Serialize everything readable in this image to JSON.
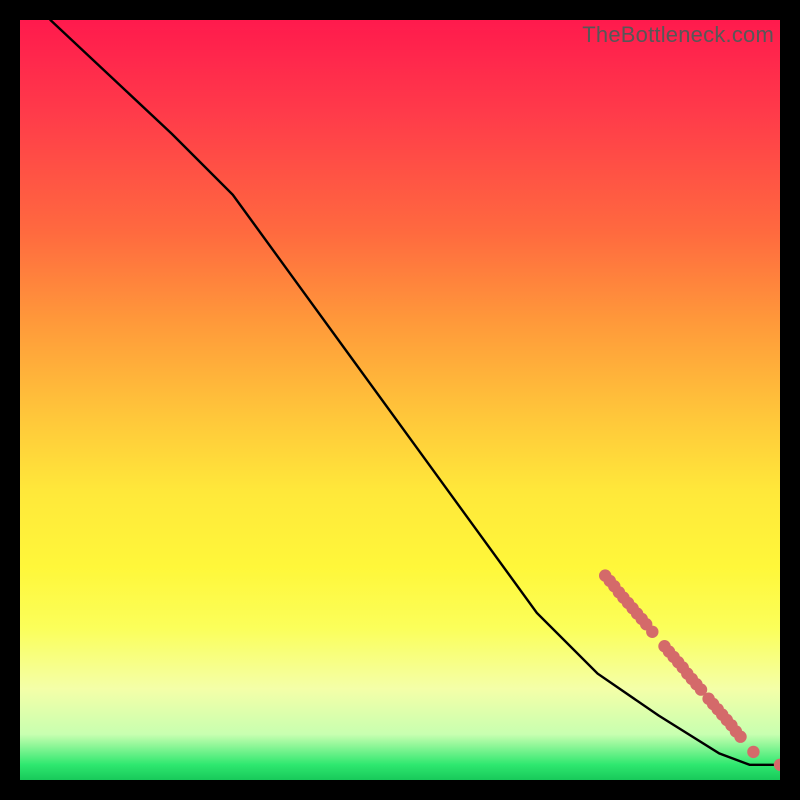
{
  "watermark": "TheBottleneck.com",
  "colors": {
    "marker": "#d46a6a",
    "line": "#000000"
  },
  "chart_data": {
    "type": "line",
    "title": "",
    "xlabel": "",
    "ylabel": "",
    "xlim": [
      0,
      100
    ],
    "ylim": [
      0,
      100
    ],
    "series": [
      {
        "name": "curve",
        "kind": "line",
        "x": [
          4,
          12,
          20,
          28,
          36,
          44,
          52,
          60,
          68,
          76,
          84,
          92,
          96,
          100
        ],
        "y": [
          100,
          92.5,
          85,
          77,
          66,
          55,
          44,
          33,
          22,
          14,
          8.5,
          3.5,
          2,
          2
        ]
      },
      {
        "name": "markers",
        "kind": "scatter",
        "x": [
          77.0,
          77.6,
          78.2,
          78.8,
          79.4,
          80.0,
          80.6,
          81.2,
          81.8,
          82.4,
          83.2,
          84.8,
          85.4,
          86.0,
          86.6,
          87.2,
          87.8,
          88.4,
          89.0,
          89.6,
          90.6,
          91.2,
          91.8,
          92.4,
          93.0,
          93.6,
          94.2,
          94.8,
          96.5,
          100.0
        ],
        "y": [
          26.9,
          26.2,
          25.5,
          24.7,
          24.0,
          23.3,
          22.6,
          21.9,
          21.2,
          20.5,
          19.5,
          17.6,
          16.9,
          16.2,
          15.5,
          14.8,
          14.0,
          13.3,
          12.6,
          11.9,
          10.7,
          10.0,
          9.3,
          8.6,
          7.9,
          7.2,
          6.4,
          5.7,
          3.7,
          2.0
        ]
      }
    ]
  }
}
